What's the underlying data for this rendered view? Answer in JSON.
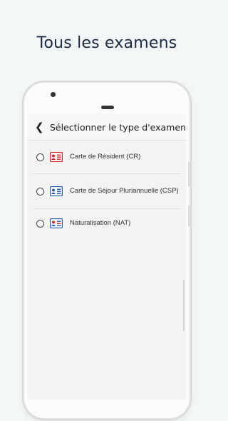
{
  "headline": "Tous les examens",
  "screen": {
    "title": "Sélectionner le type d'examen",
    "back_icon": "chevron-left-icon",
    "options": [
      {
        "label": "Carte de Résident (CR)",
        "icon": "id-card-icon",
        "icon_color": "#e0242b"
      },
      {
        "label": "Carte de Séjour Pluriannuelle (CSP)",
        "icon": "id-card-icon",
        "icon_color": "#1e5cb3"
      },
      {
        "label": "Naturalisation (NAT)",
        "icon": "id-card-icon",
        "icon_color": "#1e5cb3"
      }
    ]
  }
}
